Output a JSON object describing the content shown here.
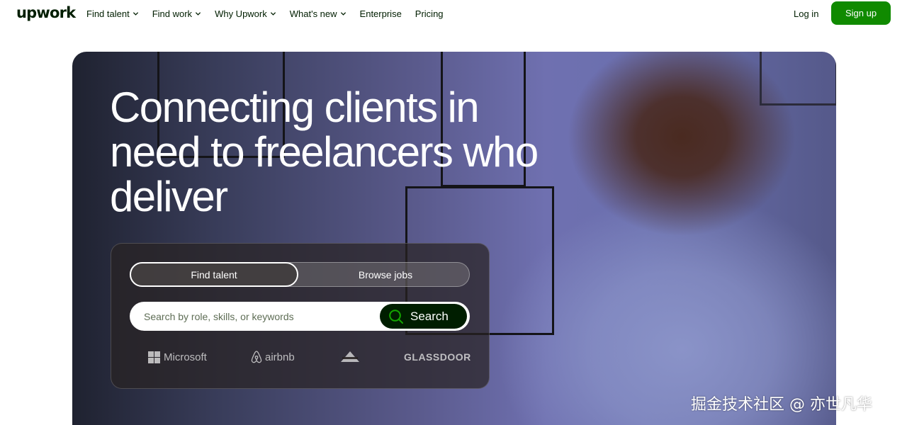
{
  "brand": {
    "logo_text": "upwork"
  },
  "nav": {
    "items": [
      {
        "label": "Find talent",
        "has_dropdown": true
      },
      {
        "label": "Find work",
        "has_dropdown": true
      },
      {
        "label": "Why Upwork",
        "has_dropdown": true
      },
      {
        "label": "What's new",
        "has_dropdown": true
      },
      {
        "label": "Enterprise",
        "has_dropdown": false
      },
      {
        "label": "Pricing",
        "has_dropdown": false
      }
    ],
    "login_label": "Log in",
    "signup_label": "Sign up"
  },
  "hero": {
    "title": "Connecting clients in need to freelancers who deliver",
    "tabs": [
      {
        "label": "Find talent",
        "active": true
      },
      {
        "label": "Browse jobs",
        "active": false
      }
    ],
    "search": {
      "placeholder": "Search by role, skills, or keywords",
      "value": "",
      "button_label": "Search"
    },
    "trusted_logos": [
      "Microsoft",
      "airbnb",
      "bissell",
      "GLASSDOOR"
    ]
  },
  "watermark": "掘金技术社区 @ 亦世凡华",
  "colors": {
    "brand_green": "#108a00",
    "dark_green": "#001e00",
    "white": "#ffffff"
  }
}
